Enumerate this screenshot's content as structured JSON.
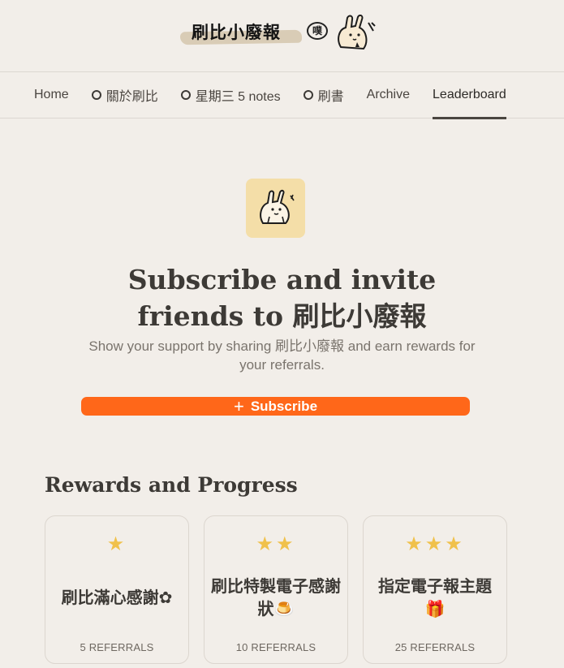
{
  "header": {
    "logo_text": "刷比小廢報",
    "logo_bubble": "噗"
  },
  "nav": {
    "items": [
      {
        "label": "Home",
        "ring": false,
        "active": false
      },
      {
        "label": "關於刷比",
        "ring": true,
        "active": false
      },
      {
        "label": "星期三 5 notes",
        "ring": true,
        "active": false
      },
      {
        "label": "刷書",
        "ring": true,
        "active": false
      },
      {
        "label": "Archive",
        "ring": false,
        "active": false
      },
      {
        "label": "Leaderboard",
        "ring": false,
        "active": true
      }
    ]
  },
  "hero": {
    "title_line1": "Subscribe and invite",
    "title_line2": "friends to 刷比小廢報",
    "subtitle": "Show your support by sharing 刷比小廢報 and earn rewards for your referrals.",
    "subscribe_label": "Subscribe",
    "subscribe_icon": "plus-icon",
    "accent_color": "#ff6719",
    "avatar_bg": "#f4dea8"
  },
  "rewards": {
    "heading": "Rewards and Progress",
    "star_color": "#f0c14b",
    "cards": [
      {
        "stars": 1,
        "title": "刷比滿心感謝✿",
        "referrals": "5 REFERRALS"
      },
      {
        "stars": 2,
        "title": "刷比特製電子感謝狀🍮",
        "referrals": "10 REFERRALS"
      },
      {
        "stars": 3,
        "title": "指定電子報主題🎁",
        "referrals": "25 REFERRALS"
      }
    ]
  }
}
